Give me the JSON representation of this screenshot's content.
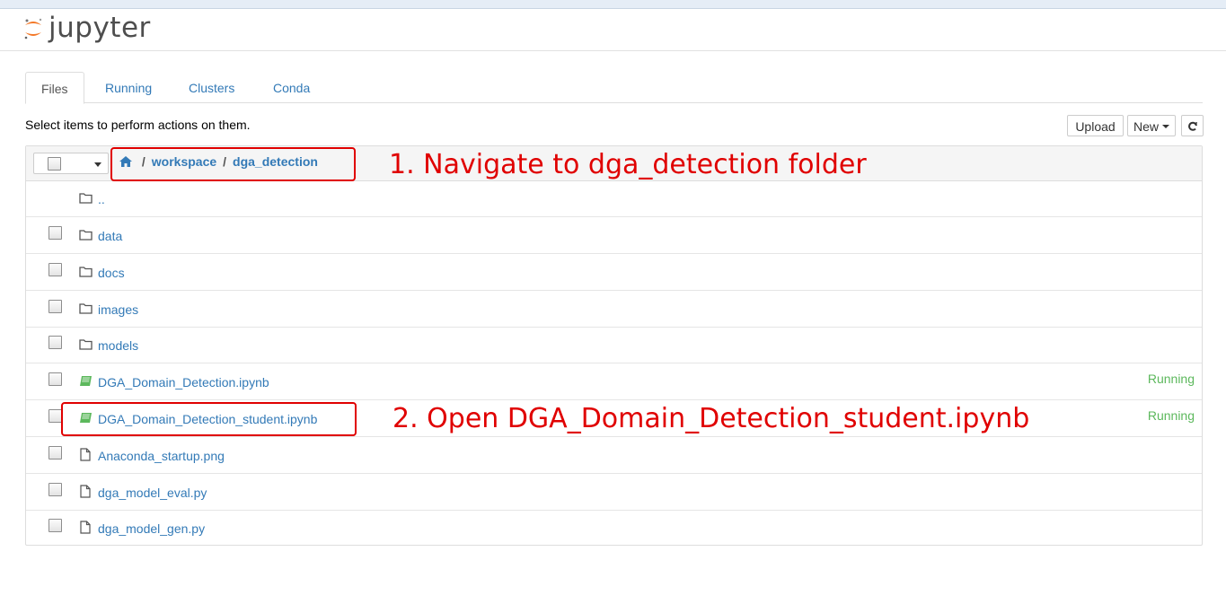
{
  "app": {
    "logo_text": "jupyter",
    "logo_icon": "jupyter-logo-icon"
  },
  "tabs": [
    {
      "label": "Files",
      "active": true
    },
    {
      "label": "Running",
      "active": false
    },
    {
      "label": "Clusters",
      "active": false
    },
    {
      "label": "Conda",
      "active": false
    }
  ],
  "toolbar": {
    "hint": "Select items to perform actions on them.",
    "upload_label": "Upload",
    "new_label": "New",
    "refresh_icon": "refresh-icon"
  },
  "breadcrumb": {
    "home_icon": "home-icon",
    "sep1": "/",
    "folder1": "workspace",
    "sep2": "/",
    "folder2": "dga_detection"
  },
  "files": [
    {
      "name": "..",
      "type": "folder",
      "status": ""
    },
    {
      "name": "data",
      "type": "folder",
      "status": ""
    },
    {
      "name": "docs",
      "type": "folder",
      "status": ""
    },
    {
      "name": "images",
      "type": "folder",
      "status": ""
    },
    {
      "name": "models",
      "type": "folder",
      "status": ""
    },
    {
      "name": "DGA_Domain_Detection.ipynb",
      "type": "notebook",
      "status": "Running"
    },
    {
      "name": "DGA_Domain_Detection_student.ipynb",
      "type": "notebook",
      "status": "Running"
    },
    {
      "name": "Anaconda_startup.png",
      "type": "file",
      "status": ""
    },
    {
      "name": "dga_model_eval.py",
      "type": "file",
      "status": ""
    },
    {
      "name": "dga_model_gen.py",
      "type": "file",
      "status": ""
    }
  ],
  "annotations": {
    "step1": "1. Navigate to dga_detection folder",
    "step2": "2. Open DGA_Domain_Detection_student.ipynb"
  },
  "colors": {
    "link": "#337ab7",
    "running": "#5cb85c",
    "annotation": "#e00000",
    "notebook_icon": "#5cb85c"
  }
}
